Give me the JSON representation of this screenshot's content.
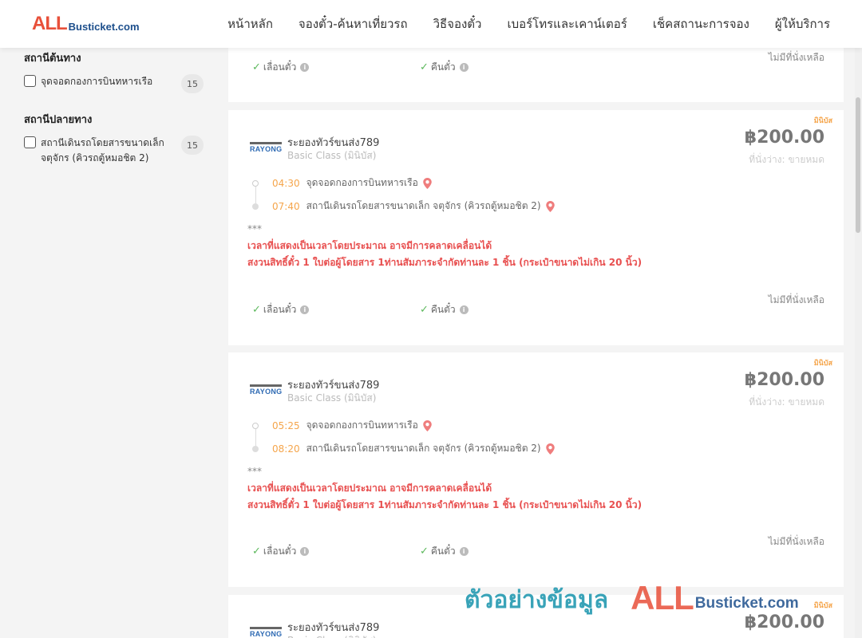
{
  "header": {
    "logo_all": "ALL",
    "logo_rest": "Busticket.com",
    "nav": [
      "หน้าหลัก",
      "จองตั๋ว-ค้นหาเที่ยวรถ",
      "วิธีจองตั๋ว",
      "เบอร์โทรและเคาน์เตอร์",
      "เช็คสถานะการจอง",
      "ผู้ให้บริการ"
    ]
  },
  "sidebar": {
    "origin_title": "สถานีต้นทาง",
    "origin_items": [
      {
        "label": "จุดจอดกองการบินทหารเรือ",
        "count": "15"
      }
    ],
    "dest_title": "สถานีปลายทาง",
    "dest_items": [
      {
        "label": "สถานีเดินรถโดยสารขนาดเล็ก จตุจักร (คิวรถตู้หมอชิต 2)",
        "count": "15"
      }
    ]
  },
  "common": {
    "badge": "มินิบัส",
    "operator_logo": "RAYONG",
    "operator": "ระยองทัวร์ขนส่ง789",
    "class": "Basic Class (มินิบัส)",
    "price": "฿200.00",
    "seats": "ที่นั่งว่าง: ขายหมด",
    "origin": "จุดจอดกองการบินทหารเรือ",
    "dest": "สถานีเดินรถโดยสารขนาดเล็ก จตุจักร (คิวรถตู้หมอชิต 2)",
    "stars": "***",
    "warn1": "เวลาที่แสดงเป็นเวลาโดยประมาณ อาจมีการคลาดเคลื่อนได้",
    "warn2": "สงวนสิทธิ์ตั๋ว 1 ใบต่อผู้โดยสาร 1ท่านสัมภาระจำกัดท่านละ 1 ชิ้น (กระเป๋าขนาดไม่เกิน 20 นิ้ว)",
    "reschedule": "เลื่อนตั๋ว",
    "refund": "คืนตั๋ว",
    "no_seat": "ไม่มีที่นั่งเหลือ"
  },
  "trips": [
    {
      "dep": "04:30",
      "arr": "07:40"
    },
    {
      "dep": "05:25",
      "arr": "08:20"
    }
  ],
  "watermark": {
    "text": "ตัวอย่างข้อมูล",
    "all": "ALL",
    "rest": "Busticket.com"
  },
  "colors": {
    "brand_red": "#e8503a",
    "brand_blue": "#1d4f8c",
    "time_orange": "#f5a54b",
    "warn_red": "#e85050",
    "check_green": "#5cb85c",
    "watermark_teal": "#39a3b8"
  }
}
